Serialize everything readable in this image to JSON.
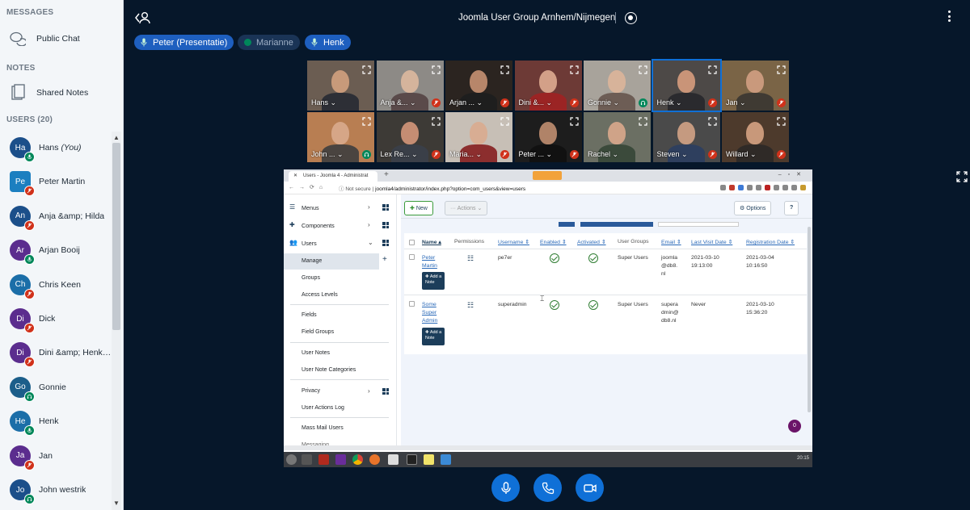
{
  "sidebar": {
    "messages_title": "MESSAGES",
    "public_chat": "Public Chat",
    "notes_title": "NOTES",
    "shared_notes": "Shared Notes",
    "users_title": "USERS (20)",
    "users": [
      {
        "initials": "Ha",
        "name": "Hans",
        "suffix": "(You)",
        "color": "#1b4f8a",
        "status": "mic",
        "shape": "circle"
      },
      {
        "initials": "Pe",
        "name": "Peter Martin",
        "color": "#1c7fc0",
        "status": "muted",
        "shape": "square"
      },
      {
        "initials": "An",
        "name": "Anja &amp; Hilda",
        "color": "#1b4f8a",
        "status": "muted",
        "shape": "circle"
      },
      {
        "initials": "Ar",
        "name": "Arjan Booij",
        "color": "#5b2d8e",
        "status": "mic",
        "shape": "circle"
      },
      {
        "initials": "Ch",
        "name": "Chris Keen",
        "color": "#1b6ea8",
        "status": "muted",
        "shape": "circle"
      },
      {
        "initials": "Di",
        "name": "Dick",
        "color": "#5b2d8e",
        "status": "muted",
        "shape": "circle"
      },
      {
        "initials": "Di",
        "name": "Dini &amp; Henk ...",
        "color": "#5b2d8e",
        "status": "muted",
        "shape": "circle"
      },
      {
        "initials": "Go",
        "name": "Gonnie",
        "color": "#1b5e8a",
        "status": "ear",
        "shape": "circle"
      },
      {
        "initials": "He",
        "name": "Henk",
        "color": "#1b6ea8",
        "status": "mic",
        "shape": "circle"
      },
      {
        "initials": "Ja",
        "name": "Jan",
        "color": "#5b2d8e",
        "status": "muted",
        "shape": "circle"
      },
      {
        "initials": "Jo",
        "name": "John westrik",
        "color": "#1b4f8a",
        "status": "ear",
        "shape": "circle"
      }
    ]
  },
  "topbar": {
    "title": "Joomla User Group Arnhem/Nijmegen"
  },
  "talking": [
    {
      "name": "Peter (Presentatie)",
      "color": "#1e5fbf",
      "active": true
    },
    {
      "name": "Marianne",
      "color": "#1a3456",
      "active": false
    },
    {
      "name": "Henk",
      "color": "#1e5fbf",
      "active": true
    }
  ],
  "videos": [
    {
      "name": "Hans",
      "status": "none",
      "bg": "#6b5d52",
      "skin": "#c89a7a",
      "shirt": "#2d2f36"
    },
    {
      "name": "Anja &...",
      "status": "muted",
      "bg": "#8d8a86",
      "skin": "#d5b49c",
      "shirt": "#5a4a4a"
    },
    {
      "name": "Arjan ...",
      "status": "muted",
      "bg": "#2b2420",
      "skin": "#b7866a",
      "shirt": "#1e1e1e"
    },
    {
      "name": "Dini &...",
      "status": "muted",
      "bg": "#6d3a36",
      "skin": "#d3a088",
      "shirt": "#9b2424"
    },
    {
      "name": "Gonnie",
      "status": "ear",
      "bg": "#a8a39b",
      "skin": "#d7b39a",
      "shirt": "#6d5d55"
    },
    {
      "name": "Henk",
      "status": "muted",
      "bg": "#4d4947",
      "skin": "#c99478",
      "shirt": "#2a2a2e",
      "highlight": true
    },
    {
      "name": "Jan",
      "status": "muted",
      "bg": "#7a6446",
      "skin": "#c9997c",
      "shirt": "#3f3a33"
    },
    {
      "name": "John ...",
      "status": "ear",
      "bg": "#b87e52",
      "skin": "#d6a687",
      "shirt": "#4a4440"
    },
    {
      "name": "Lex Re...",
      "status": "muted",
      "bg": "#3d3a36",
      "skin": "#c58d73",
      "shirt": "#3a3f48"
    },
    {
      "name": "Maria...",
      "status": "muted",
      "bg": "#c7bfb6",
      "skin": "#d8ad93",
      "shirt": "#8c2e2e"
    },
    {
      "name": "Peter ...",
      "status": "muted",
      "bg": "#1d1d1d",
      "skin": "#b08368",
      "shirt": "#111111"
    },
    {
      "name": "Rachel",
      "status": "none",
      "bg": "#6b6f63",
      "skin": "#cfa388",
      "shirt": "#3b4a3b"
    },
    {
      "name": "Steven",
      "status": "muted",
      "bg": "#4a4a4a",
      "skin": "#c59a80",
      "shirt": "#2e3f5e"
    },
    {
      "name": "Willard",
      "status": "muted",
      "bg": "#4d3a2c",
      "skin": "#c8987a",
      "shirt": "#2f2a27"
    }
  ],
  "screenshare": {
    "tab_title": "Users - Joomla 4 - Administrat",
    "url_prefix": "Not secure",
    "url": "joomla4/administrator/index.php?option=com_users&view=users",
    "toolbar": {
      "new": "New",
      "actions": "Actions",
      "options": "Options",
      "help": "?"
    },
    "menu": {
      "menus": "Menus",
      "components": "Components",
      "users": "Users",
      "manage": "Manage",
      "groups": "Groups",
      "access_levels": "Access Levels",
      "fields": "Fields",
      "field_groups": "Field Groups",
      "user_notes": "User Notes",
      "user_note_categories": "User Note Categories",
      "privacy": "Privacy",
      "user_actions_log": "User Actions Log",
      "mass_mail_users": "Mass Mail Users",
      "messaging": "Messaging"
    },
    "table": {
      "headers": {
        "name": "Name ▴",
        "permissions": "Permissions",
        "username": "Username ⇕",
        "enabled": "Enabled ⇕",
        "activated": "Activated ⇕",
        "user_groups": "User Groups",
        "email": "Email ⇕",
        "last_visit": "Last Visit Date ⇕",
        "registration": "Registration Date ⇕"
      },
      "add_note": "✚ Add a Note",
      "rows": [
        {
          "name_l1": "Peter",
          "name_l2": "Martin",
          "name_l3": "",
          "username": "pe7er",
          "groups": "Super Users",
          "email_l1": "joomla",
          "email_l2": "@db8.",
          "email_l3": "nl",
          "last_l1": "2021-03-10",
          "last_l2": "19:13:00",
          "reg_l1": "2021-03-04",
          "reg_l2": "10:16:50"
        },
        {
          "name_l1": "Some",
          "name_l2": "Super",
          "name_l3": "Admin",
          "username": "superadmin",
          "groups": "Super Users",
          "email_l1": "supera",
          "email_l2": "dmin@",
          "email_l3": "db8.nl",
          "last_l1": "Never",
          "last_l2": "",
          "reg_l1": "2021-03-10",
          "reg_l2": "15:36:20"
        }
      ]
    },
    "notif_count": "0",
    "clock": "20:15"
  }
}
